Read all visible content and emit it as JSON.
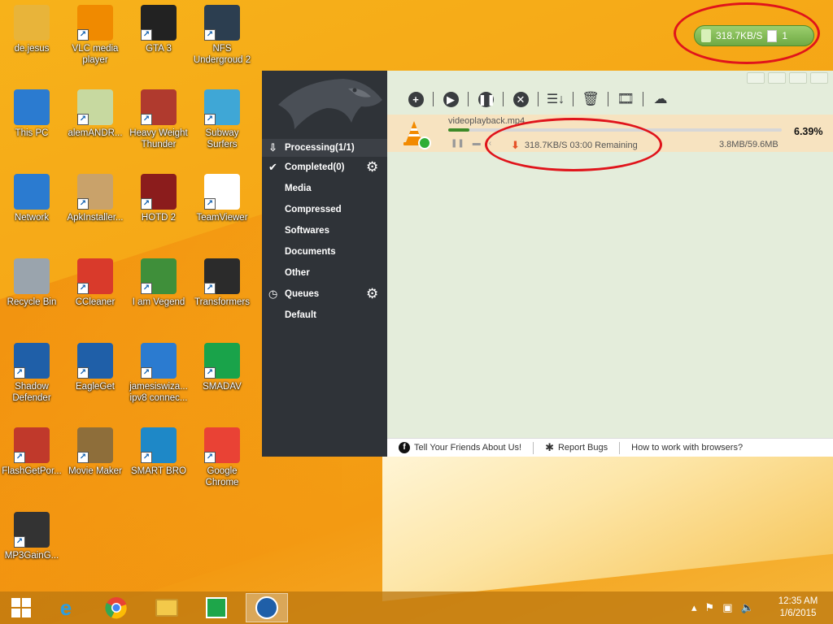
{
  "desktop": {
    "icons": [
      {
        "label": "de.jesus",
        "icon": "folder-user-icon",
        "color": "#e8b43a"
      },
      {
        "label": "VLC media player",
        "icon": "vlc-cone-icon",
        "color": "#f08a00"
      },
      {
        "label": "GTA 3",
        "icon": "gta3-icon",
        "color": "#222222"
      },
      {
        "label": "NFS Undergroud 2",
        "icon": "nfs-icon",
        "color": "#2c3e50"
      },
      {
        "label": "This PC",
        "icon": "computer-icon",
        "color": "#2b7bd0"
      },
      {
        "label": "alemANDR...",
        "icon": "installer-icon",
        "color": "#c7d9a0"
      },
      {
        "label": "Heavy Weight Thunder",
        "icon": "boxer-icon",
        "color": "#b03a2e"
      },
      {
        "label": "Subway Surfers",
        "icon": "subway-surfers-icon",
        "color": "#3fa7d6"
      },
      {
        "label": "Network",
        "icon": "network-icon",
        "color": "#2b7bd0"
      },
      {
        "label": "ApkInstaller...",
        "icon": "package-icon",
        "color": "#c9a26a"
      },
      {
        "label": "HOTD 2",
        "icon": "hotd-icon",
        "color": "#8b1c1c"
      },
      {
        "label": "TeamViewer",
        "icon": "blank-file-icon",
        "color": "#ffffff"
      },
      {
        "label": "Recycle Bin",
        "icon": "recycle-bin-icon",
        "color": "#9aa4ad"
      },
      {
        "label": "CCleaner",
        "icon": "ccleaner-icon",
        "color": "#d93a2b"
      },
      {
        "label": "I am Vegend",
        "icon": "vegend-icon",
        "color": "#3f8f3a"
      },
      {
        "label": "Transformers",
        "icon": "transformers-icon",
        "color": "#2b2b2b"
      },
      {
        "label": "Shadow Defender",
        "icon": "shield-icon",
        "color": "#1f5fa8"
      },
      {
        "label": "EagleGet",
        "icon": "eagle-icon",
        "color": "#1f5fa8"
      },
      {
        "label": "jamesiswiza... ipv8 connec...",
        "icon": "network-connection-icon",
        "color": "#2b7bd0"
      },
      {
        "label": "SMADAV",
        "icon": "smadav-icon",
        "color": "#19a34a"
      },
      {
        "label": "FlashGetPor...",
        "icon": "flashget-icon",
        "color": "#c0392b"
      },
      {
        "label": "Movie Maker",
        "icon": "movie-maker-icon",
        "color": "#8e6e3a"
      },
      {
        "label": "SMART BRO",
        "icon": "smart-bro-icon",
        "color": "#1e88c7"
      },
      {
        "label": "Google Chrome",
        "icon": "chrome-icon",
        "color": "#e94235"
      },
      {
        "label": "MP3GainG...",
        "icon": "gauge-icon",
        "color": "#333333"
      }
    ]
  },
  "speed_widget": {
    "speed": "318.7KB/S",
    "count": "1"
  },
  "app": {
    "sidebar": {
      "items": [
        {
          "label": "Processing(1/1)",
          "icon": "download-tray-icon"
        },
        {
          "label": "Completed(0)",
          "icon": "check-circle-icon"
        },
        {
          "label": "Media"
        },
        {
          "label": "Compressed"
        },
        {
          "label": "Softwares"
        },
        {
          "label": "Documents"
        },
        {
          "label": "Other"
        },
        {
          "label": "Queues",
          "icon": "clock-icon"
        },
        {
          "label": "Default"
        }
      ]
    },
    "download": {
      "filename": "videoplayback.mp4",
      "progress_percent": 6.39,
      "percent_label": "6.39%",
      "status": "318.7KB/S 03:00 Remaining",
      "size": "3.8MB/59.6MB"
    },
    "footer": {
      "tell_friends": "Tell Your Friends About Us!",
      "report_bugs": "Report Bugs",
      "browsers": "How to work with browsers?"
    }
  },
  "taskbar": {
    "clock_time": "12:35 AM",
    "clock_date": "1/6/2015"
  },
  "colors": {
    "annotation_red": "#e0141b",
    "sidebar_bg": "#2f3338",
    "main_bg": "#e4eddb",
    "progress_green": "#3d8a27"
  }
}
